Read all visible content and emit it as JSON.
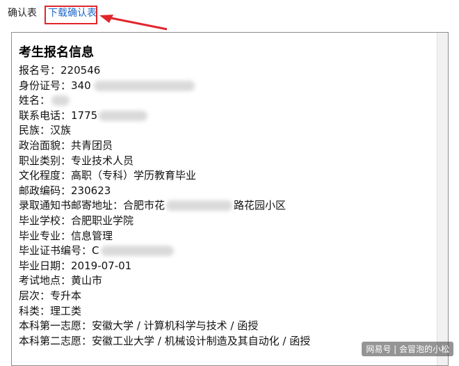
{
  "tabs": {
    "confirm_label": "确认表",
    "download_label": "下载确认表"
  },
  "document": {
    "title": "考生报名信息",
    "rows": [
      {
        "label": "报名号：",
        "value": "220546"
      },
      {
        "label": "身份证号：",
        "value": "340"
      },
      {
        "label": "姓名：",
        "value": ""
      },
      {
        "label": "联系电话：",
        "value": "1775"
      },
      {
        "label": "民族：",
        "value": "汉族"
      },
      {
        "label": "政治面貌：",
        "value": "共青团员"
      },
      {
        "label": "职业类别：",
        "value": "专业技术人员"
      },
      {
        "label": "文化程度：",
        "value": "高职（专科）学历教育毕业"
      },
      {
        "label": "邮政编码：",
        "value": "230623"
      },
      {
        "label": "录取通知书邮寄地址：",
        "value": "合肥市花",
        "value_tail": "路花园小区"
      },
      {
        "label": "毕业学校：",
        "value": "合肥职业学院"
      },
      {
        "label": "毕业专业：",
        "value": "信息管理"
      },
      {
        "label": "毕业证书编号：",
        "value": "C"
      },
      {
        "label": "毕业日期：",
        "value": "2019-07-01"
      },
      {
        "label": "考试地点：",
        "value": "黄山市"
      },
      {
        "label": "层次：",
        "value": "专升本"
      },
      {
        "label": "科类：",
        "value": "理工类"
      },
      {
        "label": "本科第一志愿：",
        "value": "安徽大学 / 计算机科学与技术 / 函授"
      },
      {
        "label": "本科第二志愿：",
        "value": "安徽工业大学 / 机械设计制造及其自动化 / 函授"
      }
    ]
  },
  "watermark": "网易号 | 会冒泡的小松",
  "colors": {
    "highlight": "#e0262b",
    "link": "#1d67c9"
  }
}
